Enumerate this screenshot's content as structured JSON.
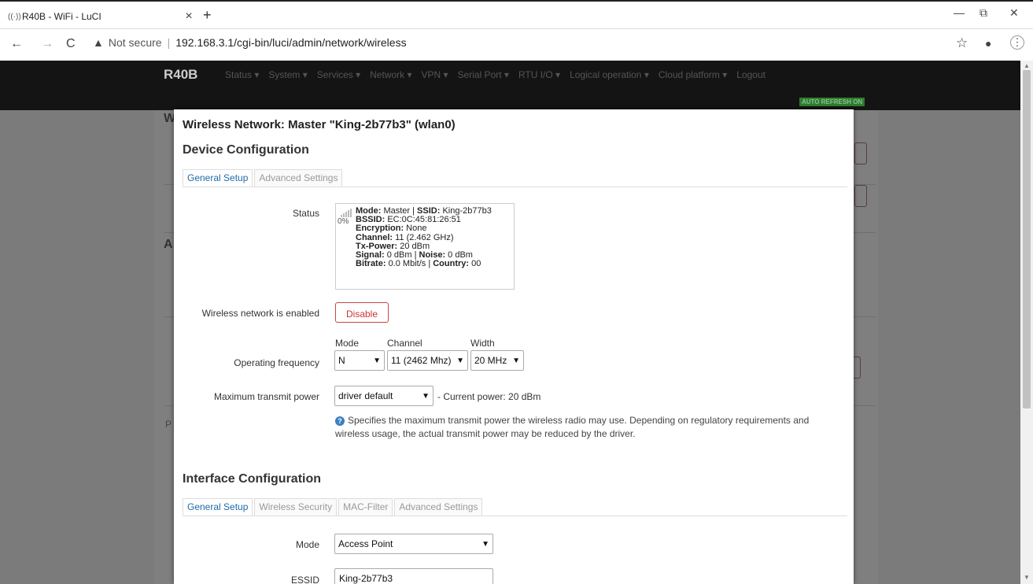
{
  "browser": {
    "tab_title": "R40B - WiFi - LuCI",
    "tab_favicon": "((·))",
    "tab_close": "×",
    "new_tab": "+",
    "security_warning": "Not secure",
    "url": "192.168.3.1/cgi-bin/luci/admin/network/wireless",
    "back": "←",
    "forward": "→",
    "reload": "C",
    "warn_icon": "▲",
    "star": "☆",
    "profile": "👤",
    "menu": "⋮",
    "minimize": "—",
    "restore": "⧉",
    "close": "✕"
  },
  "header": {
    "brand": "R40B",
    "menu": [
      "Status ▾",
      "System ▾",
      "Services ▾",
      "Network ▾",
      "VPN ▾",
      "Serial Port ▾",
      "RTU I/O ▾",
      "Logical operation ▾",
      "Cloud platform ▾",
      "Logout"
    ],
    "auto_refresh": "AUTO REFRESH ON"
  },
  "background_letters": {
    "w": "W",
    "a": "A",
    "p": "P"
  },
  "modal": {
    "title": "Wireless Network: Master \"King-2b77b3\" (wlan0)",
    "device_config_heading": "Device Configuration",
    "device_tabs": [
      "General Setup",
      "Advanced Settings"
    ],
    "status_label": "Status",
    "signal_percent": "0%",
    "status_lines": [
      [
        {
          "k": "Mode:",
          "v": " Master | "
        },
        {
          "k": "SSID:",
          "v": " King-2b77b3"
        }
      ],
      [
        {
          "k": "BSSID:",
          "v": " EC:0C:45:81:26:51"
        }
      ],
      [
        {
          "k": "Encryption:",
          "v": " None"
        }
      ],
      [
        {
          "k": "Channel:",
          "v": " 11 (2.462 GHz)"
        }
      ],
      [
        {
          "k": "Tx-Power:",
          "v": " 20 dBm"
        }
      ],
      [
        {
          "k": "Signal:",
          "v": " 0 dBm | "
        },
        {
          "k": "Noise:",
          "v": " 0 dBm"
        }
      ],
      [
        {
          "k": "Bitrate:",
          "v": " 0.0 Mbit/s | "
        },
        {
          "k": "Country:",
          "v": " 00"
        }
      ]
    ],
    "enabled_label": "Wireless network is enabled",
    "disable_button": "Disable",
    "op_freq_label": "Operating frequency",
    "mode_col": "Mode",
    "channel_col": "Channel",
    "width_col": "Width",
    "mode_value": "N",
    "channel_value": "11 (2462 Mhz)",
    "width_value": "20 MHz",
    "max_tx_label": "Maximum transmit power",
    "max_tx_value": "driver default",
    "current_power": "- Current power: 20 dBm",
    "help_text": "Specifies the maximum transmit power the wireless radio may use. Depending on regulatory requirements and wireless usage, the actual transmit power may be reduced by the driver.",
    "iface_config_heading": "Interface Configuration",
    "iface_tabs": [
      "General Setup",
      "Wireless Security",
      "MAC-Filter",
      "Advanced Settings"
    ],
    "iface_mode_label": "Mode",
    "iface_mode_value": "Access Point",
    "essid_label": "ESSID",
    "essid_value": "King-2b77b3"
  },
  "chevron": "⌄"
}
